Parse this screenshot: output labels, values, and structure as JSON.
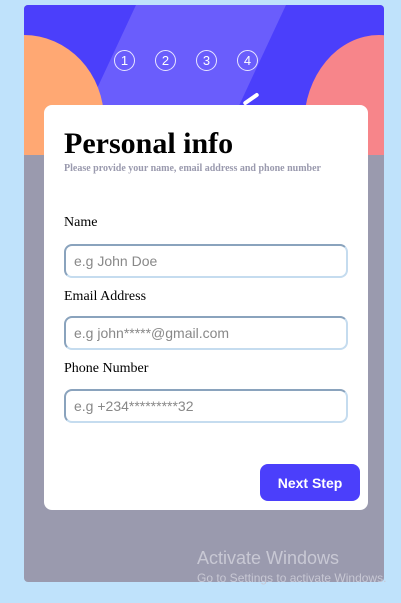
{
  "steps": [
    "1",
    "2",
    "3",
    "4"
  ],
  "form": {
    "title": "Personal info",
    "subtitle": "Please provide your name, email address and phone number",
    "fields": [
      {
        "label": "Name",
        "placeholder": "e.g John Doe"
      },
      {
        "label": "Email Address",
        "placeholder": "e.g john*****@gmail.com"
      },
      {
        "label": "Phone Number",
        "placeholder": "e.g +234*********32"
      }
    ],
    "next_label": "Next Step"
  },
  "watermark": {
    "line1": "Activate Windows",
    "line2": "Go to Settings to activate Windows."
  },
  "colors": {
    "accent": "#4b3ffb",
    "page_bg": "#bfe2fb",
    "card_bg": "#9a9aae",
    "blob_orange": "#ffa873",
    "blob_pink": "#f7858a"
  }
}
